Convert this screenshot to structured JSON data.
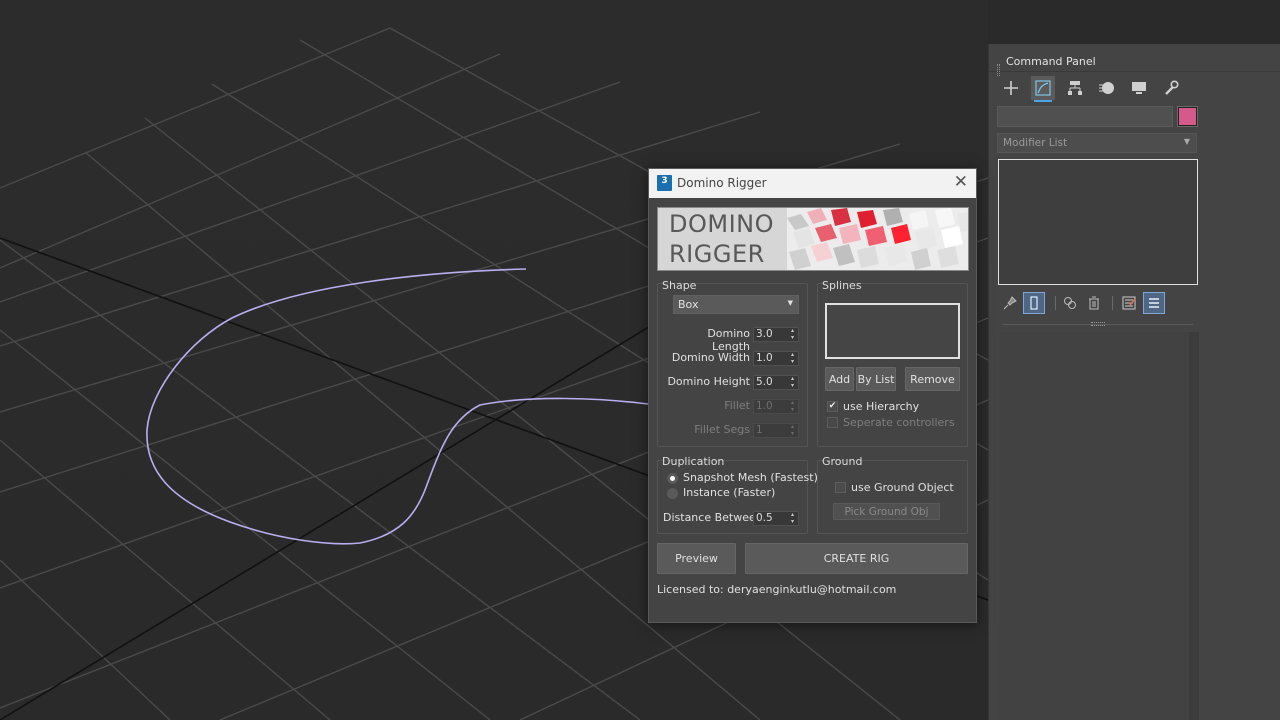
{
  "command_panel": {
    "title": "Command Panel",
    "tabs": [
      "create-icon",
      "modify-icon",
      "hierarchy-icon",
      "motion-icon",
      "display-icon",
      "utilities-icon"
    ],
    "object_name": "",
    "object_color": "#d45a8a",
    "modifier_list_placeholder": "Modifier List"
  },
  "dialog": {
    "title": "Domino Rigger",
    "close_label": "✕",
    "banner": {
      "line1": "DOMINO",
      "line2": "RIGGER"
    },
    "shape": {
      "group_label": "Shape",
      "type_value": "Box",
      "fields": [
        {
          "label": "Domino Length",
          "value": "3.0",
          "enabled": true
        },
        {
          "label": "Domino Width",
          "value": "1.0",
          "enabled": true
        },
        {
          "label": "Domino Height",
          "value": "5.0",
          "enabled": true
        },
        {
          "label": "Fillet",
          "value": "1.0",
          "enabled": false
        },
        {
          "label": "Fillet Segs",
          "value": "1",
          "enabled": false
        }
      ]
    },
    "splines": {
      "group_label": "Splines",
      "add_label": "Add",
      "by_list_label": "By List",
      "remove_label": "Remove",
      "use_hierarchy_label": "use Hierarchy",
      "use_hierarchy_checked": true,
      "separate_label": "Seperate controllers",
      "separate_checked": false
    },
    "duplication": {
      "group_label": "Duplication",
      "option1": "Snapshot Mesh (Fastest)",
      "option2": "Instance (Faster)",
      "selected": 0,
      "distance_label": "Distance Between",
      "distance_value": "0.5"
    },
    "ground": {
      "group_label": "Ground",
      "use_ground_label": "use Ground Object",
      "use_ground_checked": false,
      "pick_label": "Pick Ground Obj"
    },
    "preview_label": "Preview",
    "create_label": "CREATE RIG",
    "license_text": "Licensed to: deryaenginkutlu@hotmail.com"
  }
}
